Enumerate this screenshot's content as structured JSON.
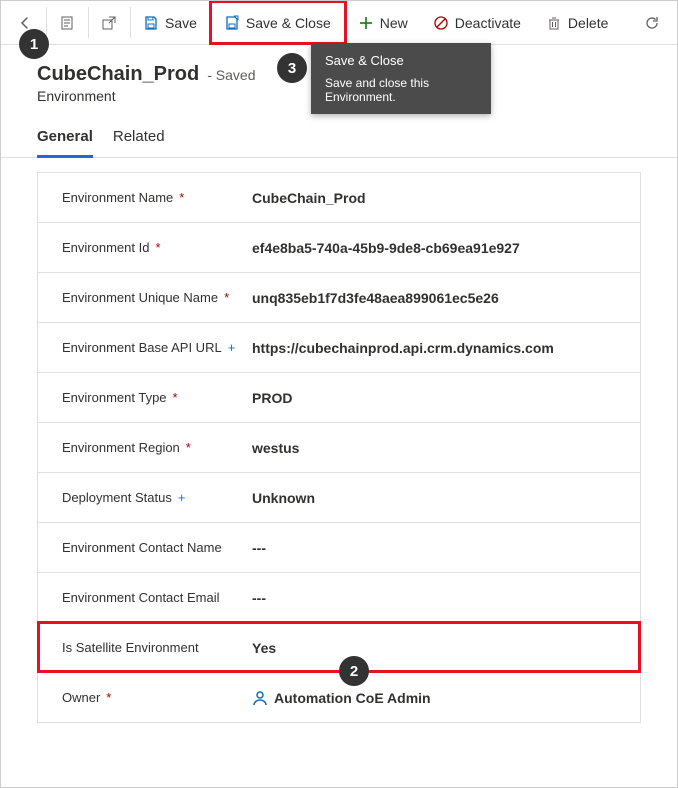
{
  "toolbar": {
    "save": "Save",
    "save_close": "Save & Close",
    "new": "New",
    "deactivate": "Deactivate",
    "delete": "Delete"
  },
  "tooltip": {
    "title": "Save & Close",
    "body": "Save and close this Environment."
  },
  "badges": {
    "b1": "1",
    "b2": "2",
    "b3": "3"
  },
  "header": {
    "title": "CubeChain_Prod",
    "saved": "- Saved",
    "entity": "Environment"
  },
  "tabs": {
    "general": "General",
    "related": "Related"
  },
  "fields": {
    "env_name": {
      "label": "Environment Name",
      "value": "CubeChain_Prod"
    },
    "env_id": {
      "label": "Environment Id",
      "value": "ef4e8ba5-740a-45b9-9de8-cb69ea91e927"
    },
    "env_unique": {
      "label": "Environment Unique Name",
      "value": "unq835eb1f7d3fe48aea899061ec5e26"
    },
    "env_api": {
      "label": "Environment Base API URL",
      "value": "https://cubechainprod.api.crm.dynamics.com"
    },
    "env_type": {
      "label": "Environment Type",
      "value": "PROD"
    },
    "env_region": {
      "label": "Environment Region",
      "value": "westus"
    },
    "deploy": {
      "label": "Deployment Status",
      "value": "Unknown"
    },
    "contact_n": {
      "label": "Environment Contact Name",
      "value": "---"
    },
    "contact_e": {
      "label": "Environment Contact Email",
      "value": "---"
    },
    "satellite": {
      "label": "Is Satellite Environment",
      "value": "Yes"
    },
    "owner": {
      "label": "Owner",
      "value": "Automation CoE Admin"
    }
  }
}
